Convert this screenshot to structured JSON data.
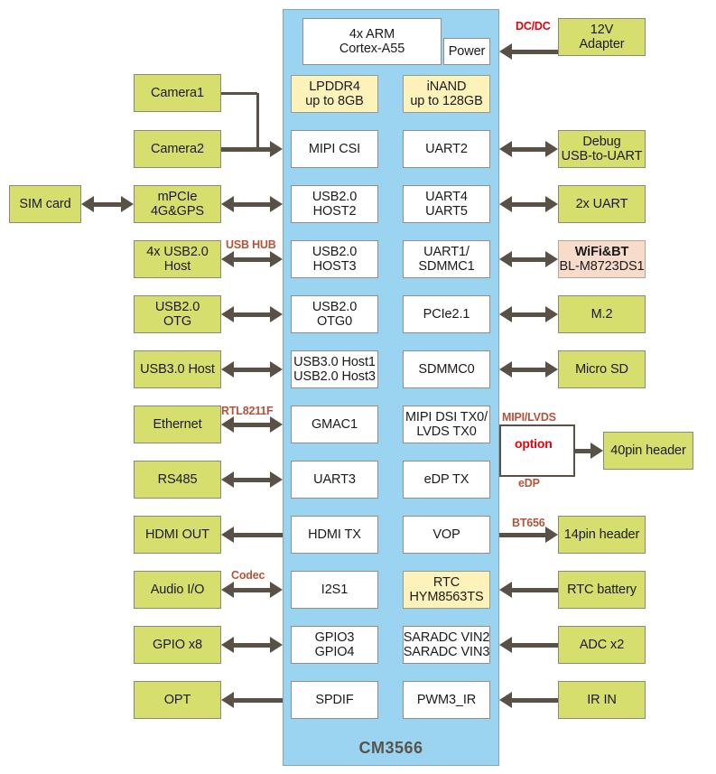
{
  "diagram": {
    "title": "CM3566",
    "soc_label": "CM3566"
  },
  "soc_blocks": {
    "cpu": {
      "lines": [
        "4x ARM",
        "Cortex-A55"
      ]
    },
    "power": {
      "lines": [
        "Power"
      ]
    },
    "lpddr4": {
      "lines": [
        "LPDDR4",
        "up to 8GB"
      ]
    },
    "inand": {
      "lines": [
        "iNAND",
        "up to 128GB"
      ]
    }
  },
  "soc_left_column": [
    {
      "lines": [
        "MIPI CSI"
      ]
    },
    {
      "lines": [
        "USB2.0",
        "HOST2"
      ]
    },
    {
      "lines": [
        "USB2.0",
        "HOST3"
      ]
    },
    {
      "lines": [
        "USB2.0",
        "OTG0"
      ]
    },
    {
      "lines": [
        "USB3.0 Host1",
        "USB2.0 Host3"
      ]
    },
    {
      "lines": [
        "GMAC1"
      ]
    },
    {
      "lines": [
        "UART3"
      ]
    },
    {
      "lines": [
        "HDMI TX"
      ]
    },
    {
      "lines": [
        "I2S1"
      ]
    },
    {
      "lines": [
        "GPIO3",
        "GPIO4"
      ]
    },
    {
      "lines": [
        "SPDIF"
      ]
    }
  ],
  "soc_right_column": [
    {
      "lines": [
        "UART2"
      ]
    },
    {
      "lines": [
        "UART4",
        "UART5"
      ]
    },
    {
      "lines": [
        "UART1/",
        "SDMMC1"
      ]
    },
    {
      "lines": [
        "PCIe2.1"
      ]
    },
    {
      "lines": [
        "SDMMC0"
      ]
    },
    {
      "lines": [
        "MIPI DSI TX0/",
        "LVDS TX0"
      ]
    },
    {
      "lines": [
        "eDP TX"
      ]
    },
    {
      "lines": [
        "VOP"
      ]
    },
    {
      "lines": [
        "RTC",
        "HYM8563TS"
      ]
    },
    {
      "lines": [
        "SARADC VIN2",
        "SARADC VIN3"
      ]
    },
    {
      "lines": [
        "PWM3_IR"
      ]
    }
  ],
  "peripherals_left": [
    {
      "lines": [
        "Camera1"
      ]
    },
    {
      "lines": [
        "Camera2"
      ]
    },
    {
      "lines": [
        "mPCIe",
        "4G&GPS"
      ]
    },
    {
      "lines": [
        "4x USB2.0",
        "Host"
      ]
    },
    {
      "lines": [
        "USB2.0",
        "OTG"
      ]
    },
    {
      "lines": [
        "USB3.0 Host"
      ]
    },
    {
      "lines": [
        "Ethernet"
      ]
    },
    {
      "lines": [
        "RS485"
      ]
    },
    {
      "lines": [
        "HDMI OUT"
      ]
    },
    {
      "lines": [
        "Audio I/O"
      ]
    },
    {
      "lines": [
        "GPIO x8"
      ]
    },
    {
      "lines": [
        "OPT"
      ]
    }
  ],
  "peripherals_far_left": [
    {
      "lines": [
        "SIM card"
      ]
    }
  ],
  "peripherals_right": [
    {
      "lines": [
        "12V",
        "Adapter"
      ]
    },
    {
      "lines": [
        "Debug",
        "USB-to-UART"
      ]
    },
    {
      "lines": [
        "2x UART"
      ]
    },
    {
      "lines": [
        "WiFi&BT",
        "BL-M8723DS1"
      ]
    },
    {
      "lines": [
        "M.2"
      ]
    },
    {
      "lines": [
        "Micro SD"
      ]
    },
    {
      "lines": [
        "40pin header"
      ]
    },
    {
      "lines": [
        "14pin header"
      ]
    },
    {
      "lines": [
        "RTC battery"
      ]
    },
    {
      "lines": [
        "ADC x2"
      ]
    },
    {
      "lines": [
        "IR IN"
      ]
    }
  ],
  "connector_labels": {
    "dcdc": "DC/DC",
    "usb_hub": "USB HUB",
    "rtl8211f": "RTL8211F",
    "mipi_lvds": "MIPI/LVDS",
    "option": "option",
    "edp": "eDP",
    "bt656": "BT656",
    "codec": "Codec"
  },
  "colors": {
    "soc_fill": "#9ad4f0",
    "peripheral_fill": "#d6de6e",
    "memory_fill": "#fdf3ba",
    "wifi_fill": "#f8dccb",
    "connector": "#595145",
    "caption": "#b5543a",
    "caption_red": "#e8000d",
    "soc_label": "#58544a"
  }
}
